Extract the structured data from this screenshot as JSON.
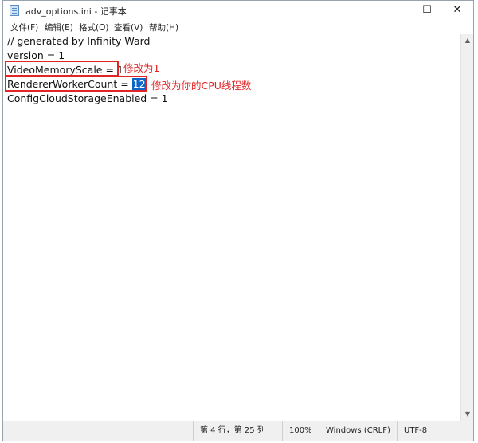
{
  "window": {
    "title": "adv_options.ini - 记事本",
    "controls": {
      "minimize": "—",
      "maximize": "☐",
      "close": "✕"
    }
  },
  "menu": {
    "items": [
      "文件(F)",
      "编辑(E)",
      "格式(O)",
      "查看(V)",
      "帮助(H)"
    ]
  },
  "editor": {
    "lines": [
      "// generated by Infinity Ward",
      "version = 1",
      "VideoMemoryScale = 1",
      "RendererWorkerCount = ",
      "ConfigCloudStorageEnabled = 1"
    ],
    "selected_value": "12"
  },
  "annotations": {
    "video_memory": "修改为1",
    "renderer_worker": "修改为你的CPU线程数",
    "color": "#e22525"
  },
  "status": {
    "position": "第 4 行，第 25 列",
    "zoom": "100%",
    "line_ending": "Windows (CRLF)",
    "encoding": "UTF-8"
  }
}
